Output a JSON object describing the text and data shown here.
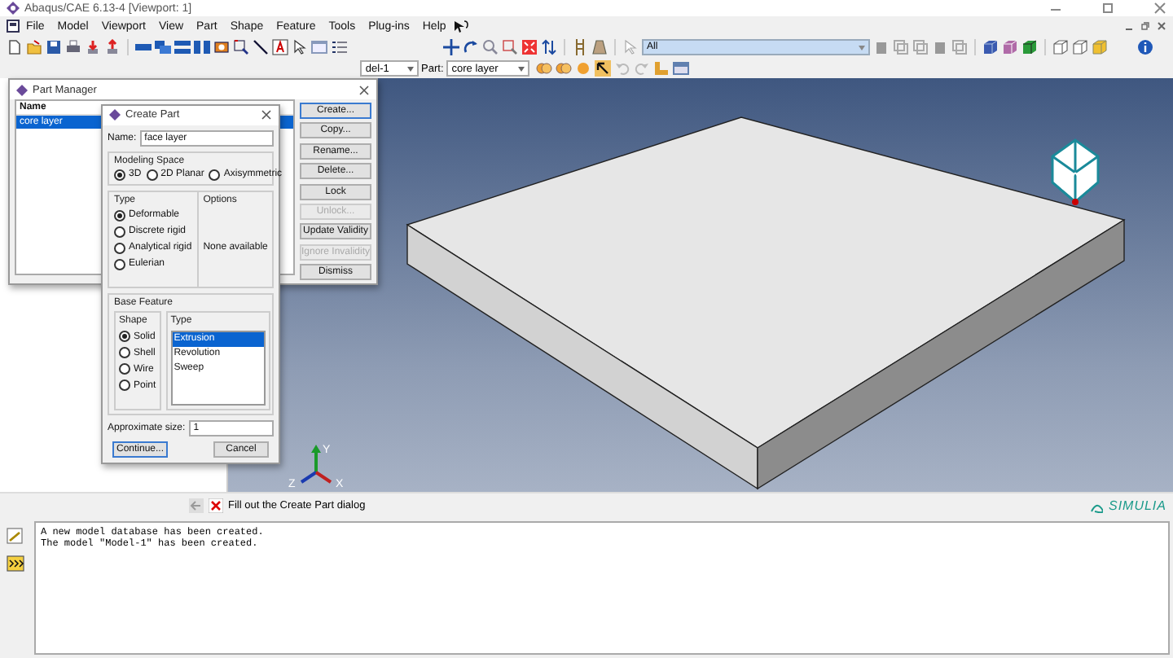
{
  "window": {
    "title": "Abaqus/CAE 6.13-4 [Viewport: 1]"
  },
  "menu": [
    "File",
    "Model",
    "Viewport",
    "View",
    "Part",
    "Shape",
    "Feature",
    "Tools",
    "Plug-ins",
    "Help"
  ],
  "toolbar": {
    "selection_filter": "All",
    "model": "del-1",
    "part_label": "Part:",
    "part": "core layer"
  },
  "part_manager": {
    "title": "Part Manager",
    "column": "Name",
    "parts": [
      {
        "name": "core layer",
        "selected": true
      }
    ],
    "buttons": [
      {
        "label": "Create...",
        "disabled": false
      },
      {
        "label": "Copy...",
        "disabled": false
      },
      {
        "label": "Rename...",
        "disabled": false
      },
      {
        "label": "Delete...",
        "disabled": false
      },
      {
        "label": "Lock",
        "disabled": false
      },
      {
        "label": "Unlock...",
        "disabled": true
      },
      {
        "label": "Update Validity",
        "disabled": false
      },
      {
        "label": "Ignore Invalidity",
        "disabled": true
      },
      {
        "label": "Dismiss",
        "disabled": false
      }
    ]
  },
  "create_part": {
    "title": "Create Part",
    "name_label": "Name:",
    "name": "face layer",
    "modeling_space": {
      "title": "Modeling Space",
      "options": [
        {
          "label": "3D",
          "selected": true
        },
        {
          "label": "2D Planar",
          "selected": false
        },
        {
          "label": "Axisymmetric",
          "selected": false
        }
      ]
    },
    "type": {
      "title": "Type",
      "options": [
        {
          "label": "Deformable",
          "selected": true
        },
        {
          "label": "Discrete rigid",
          "selected": false
        },
        {
          "label": "Analytical rigid",
          "selected": false
        },
        {
          "label": "Eulerian",
          "selected": false
        }
      ]
    },
    "options": {
      "title": "Options",
      "text": "None available"
    },
    "base_feature": {
      "title": "Base Feature",
      "shape_title": "Shape",
      "shapes": [
        {
          "label": "Solid",
          "selected": true
        },
        {
          "label": "Shell",
          "selected": false
        },
        {
          "label": "Wire",
          "selected": false
        },
        {
          "label": "Point",
          "selected": false
        }
      ],
      "type_title": "Type",
      "types": [
        {
          "label": "Extrusion",
          "selected": true
        },
        {
          "label": "Revolution",
          "selected": false
        },
        {
          "label": "Sweep",
          "selected": false
        }
      ]
    },
    "size_label": "Approximate size:",
    "size": "1",
    "buttons": [
      "Continue...",
      "Cancel"
    ]
  },
  "triad": {
    "labels": [
      "Y",
      "Z",
      "X"
    ]
  },
  "prompt": {
    "text": "Fill out the Create Part dialog"
  },
  "brand": "SIMULIA",
  "messages": [
    "A new model database has been created.",
    "The model \"Model-1\" has been created."
  ]
}
